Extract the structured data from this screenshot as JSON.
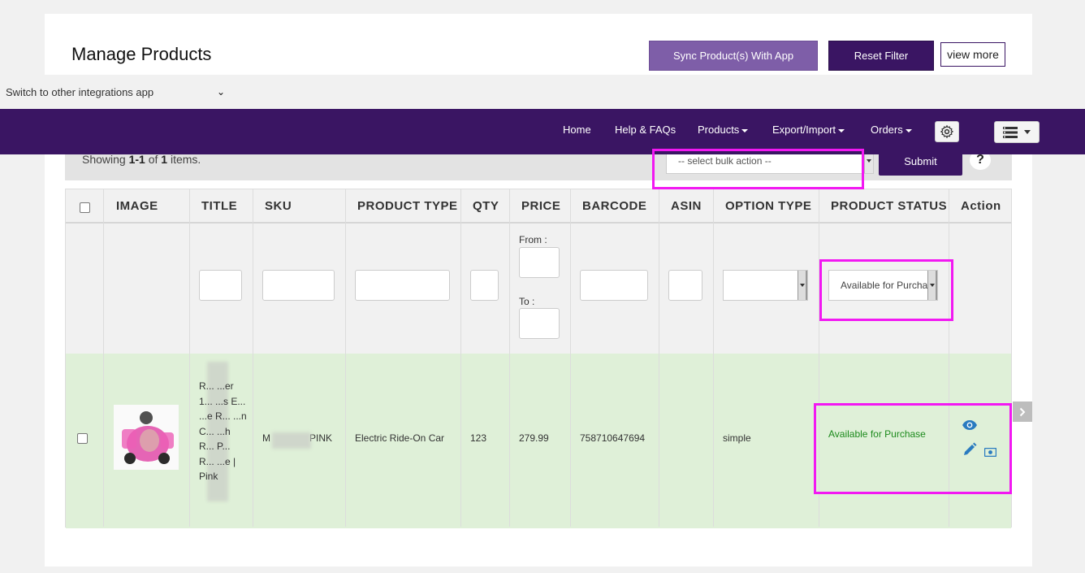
{
  "header": {
    "title": "Manage Products",
    "sync_label": "Sync Product(s) With App",
    "reset_label": "Reset Filter",
    "more_label": "view more"
  },
  "switcher": {
    "label": "Switch to other integrations app"
  },
  "nav": {
    "items": [
      "Home",
      "Help & FAQs",
      "Products",
      "Export/Import",
      "Orders"
    ],
    "icons": {
      "settings": "gear-icon",
      "menu": "list-menu-icon"
    }
  },
  "toolbar": {
    "showing_prefix": "Showing ",
    "showing_range": "1-1",
    "showing_of": " of ",
    "showing_total": "1",
    "showing_suffix": " items.",
    "bulk_placeholder": "-- select bulk action --",
    "submit_label": "Submit",
    "help_label": "?"
  },
  "table": {
    "columns": [
      "IMAGE",
      "TITLE",
      "SKU",
      "PRODUCT TYPE",
      "QTY",
      "PRICE",
      "BARCODE",
      "ASIN",
      "OPTION TYPE",
      "PRODUCT STATUS",
      "Action"
    ],
    "filters": {
      "price_from": "From :",
      "price_to": "To :",
      "status_value": "Available for Purchase"
    },
    "rows": [
      {
        "title": "R... ...er 1... ...s E... ...e R... ...n C... ...h R... P... R... ...e | Pink",
        "sku_prefix": "M",
        "sku_suffix": "PINK",
        "product_type": "Electric Ride-On Car",
        "qty": "123",
        "price": "279.99",
        "barcode": "758710647694",
        "asin": "",
        "option_type": "simple",
        "status": "Available for Purchase"
      }
    ]
  },
  "colors": {
    "brand": "#3a1563",
    "sync": "#7e5ea8",
    "row_bg": "#dff0d8",
    "status_green": "#1c8a1c",
    "highlight": "#f218f2"
  }
}
